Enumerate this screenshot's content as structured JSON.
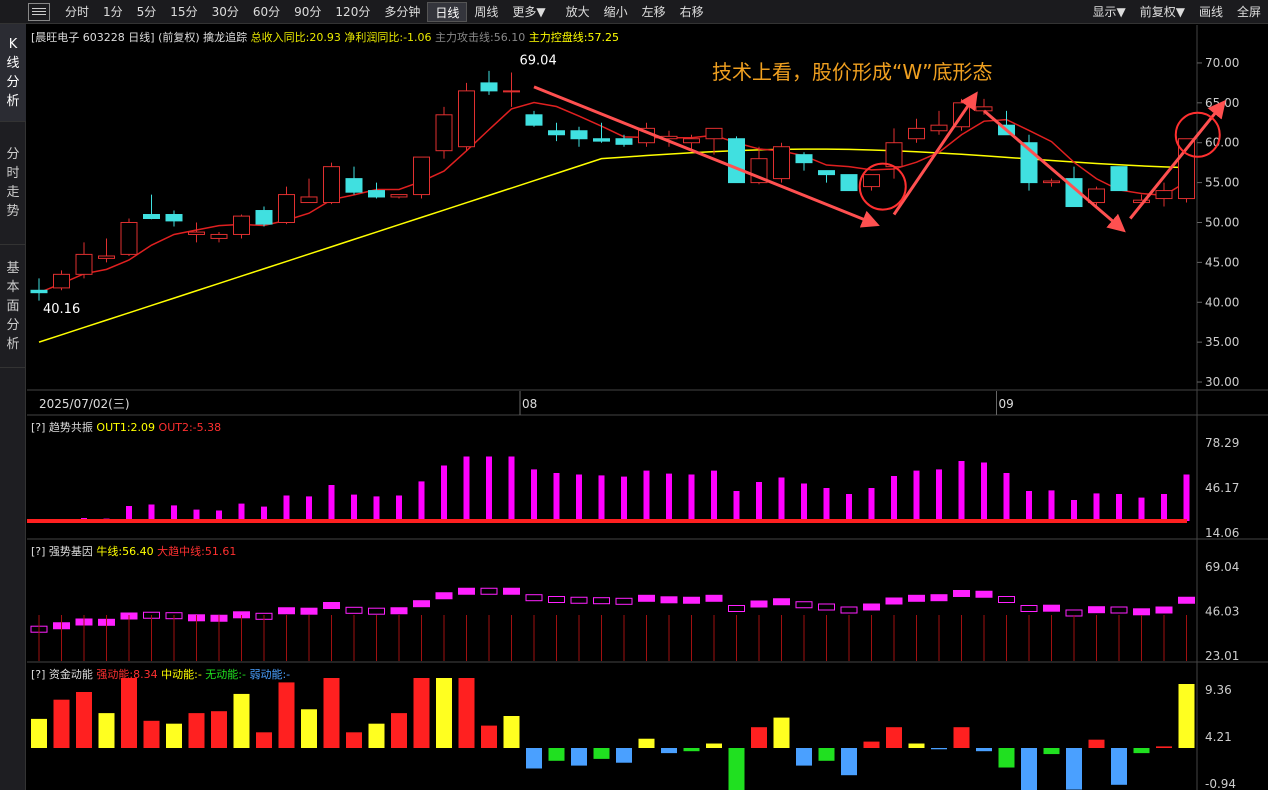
{
  "toolbar": {
    "periods": [
      "分时",
      "1分",
      "5分",
      "15分",
      "30分",
      "60分",
      "90分",
      "120分",
      "多分钟",
      "日线",
      "周线",
      "更多▼"
    ],
    "active": "日线",
    "actions": [
      "放大",
      "缩小",
      "左移",
      "右移"
    ],
    "right": [
      "显示▼",
      "前复权▼",
      "画线",
      "全屏"
    ]
  },
  "leftnav": [
    {
      "label": "K线分析",
      "active": true
    },
    {
      "label": "分时走势",
      "active": false
    },
    {
      "label": "基本面分析",
      "active": false
    }
  ],
  "main": {
    "stock": "[晨旺电子 603228 日线]",
    "adjust": "(前复权)",
    "indicator": "擒龙追踪",
    "fields": [
      {
        "text": "总收入同比:20.93",
        "color": "#e8e800"
      },
      {
        "text": "净利润同比:-1.06",
        "color": "#e8e800"
      },
      {
        "text": "主力攻击线:56.10",
        "color": "#888888"
      },
      {
        "text": "主力控盘线:57.25",
        "color": "#ffff00"
      }
    ],
    "yticks": [
      "70.00",
      "65.00",
      "60.00",
      "55.00",
      "50.00",
      "45.00",
      "40.00",
      "35.00",
      "30.00"
    ],
    "high_label": "69.04",
    "low_label": "40.16",
    "annotation": "技术上看，股价形成“W”底形态",
    "date_label": "2025/07/02(三)",
    "month_labels": [
      "08",
      "09"
    ]
  },
  "chart_data": {
    "type": "candlestick",
    "ylim": [
      29,
      72
    ],
    "candles": [
      [
        41.5,
        43,
        40.2,
        41.2
      ],
      [
        41.8,
        44,
        41.5,
        43.5
      ],
      [
        43.5,
        47.5,
        43,
        46
      ],
      [
        45.5,
        48,
        45,
        45.8
      ],
      [
        46,
        50.5,
        45.8,
        50
      ],
      [
        51,
        53.5,
        50.4,
        50.5
      ],
      [
        51,
        51.5,
        49.5,
        50.2
      ],
      [
        48.5,
        50,
        47.5,
        48.8
      ],
      [
        48,
        48.8,
        47.5,
        48.5
      ],
      [
        48.5,
        51,
        48,
        50.8
      ],
      [
        51.5,
        52,
        49.5,
        49.8
      ],
      [
        50,
        54.5,
        49.8,
        53.5
      ],
      [
        52.5,
        55.5,
        52.5,
        53.2
      ],
      [
        52.5,
        57.5,
        52.3,
        57
      ],
      [
        55.5,
        57,
        53.5,
        53.8
      ],
      [
        54,
        55,
        53,
        53.2
      ],
      [
        53.2,
        53.5,
        53,
        53.5
      ],
      [
        53.5,
        58,
        53,
        58.2
      ],
      [
        59,
        64.5,
        58,
        63.5
      ],
      [
        59.5,
        67.5,
        59,
        66.5
      ],
      [
        67.5,
        69,
        66,
        66.5
      ],
      [
        66.5,
        68.8,
        64.5,
        66.5
      ],
      [
        63.5,
        64,
        62,
        62.2
      ],
      [
        61.5,
        62.5,
        60.2,
        61
      ],
      [
        61.5,
        62,
        59.5,
        60.5
      ],
      [
        60.5,
        62.5,
        60,
        60.2
      ],
      [
        60.5,
        61,
        59.5,
        59.8
      ],
      [
        60,
        62.5,
        59.5,
        61.8
      ],
      [
        60.5,
        61.5,
        59.5,
        60.8
      ],
      [
        60,
        61,
        59,
        60.5
      ],
      [
        60.5,
        61.5,
        58.5,
        61.8
      ],
      [
        60.5,
        60.8,
        55,
        55
      ],
      [
        55,
        59.5,
        54.8,
        58
      ],
      [
        55.5,
        60,
        55,
        59.5
      ],
      [
        58.5,
        58.8,
        56.5,
        57.5
      ],
      [
        56.5,
        56.5,
        55,
        56
      ],
      [
        56,
        56,
        54,
        54
      ],
      [
        54.5,
        56,
        54,
        56
      ],
      [
        57,
        61.8,
        55.5,
        60
      ],
      [
        60.5,
        63,
        60,
        61.8
      ],
      [
        61.5,
        64,
        61,
        62.2
      ],
      [
        62,
        65.5,
        61.5,
        65
      ],
      [
        64,
        65.5,
        63.5,
        64.5
      ],
      [
        62.2,
        64,
        61.8,
        61
      ],
      [
        60,
        61,
        54,
        55
      ],
      [
        55,
        55.5,
        54.5,
        55.2
      ],
      [
        55.5,
        57,
        52.5,
        52
      ],
      [
        52.5,
        54.5,
        52,
        54.2
      ],
      [
        57,
        57,
        54,
        54
      ],
      [
        52.5,
        53.5,
        52,
        52.8
      ],
      [
        53,
        55,
        52,
        54
      ],
      [
        53,
        60,
        52.5,
        60.5
      ]
    ],
    "ma_fast_color": "#e02020",
    "ma_slow_color": "#ffff00",
    "panes": [
      {
        "name": "趋势共振",
        "series": [
          {
            "name": "OUT1",
            "last": "2.09",
            "color": "#ffff00"
          },
          {
            "name": "OUT2",
            "last": "-5.38",
            "color": "#ff3030"
          }
        ],
        "yticks": [
          "78.29",
          "46.17",
          "14.06"
        ]
      },
      {
        "name": "强势基因",
        "series": [
          {
            "name": "牛线",
            "last": "56.40",
            "color": "#ffff00"
          },
          {
            "name": "大趋中线",
            "last": "51.61",
            "color": "#ff3030"
          }
        ],
        "yticks": [
          "69.04",
          "46.03",
          "23.01"
        ]
      },
      {
        "name": "资金动能",
        "series": [
          {
            "name": "强动能",
            "last": "8.34",
            "color": "#ff3030"
          },
          {
            "name": "中动能",
            "last": "-",
            "color": "#ffff00"
          },
          {
            "name": "无动能",
            "last": "-",
            "color": "#20e020"
          },
          {
            "name": "弱动能",
            "last": "-",
            "color": "#4aa0ff"
          }
        ],
        "yticks": [
          "9.36",
          "4.21",
          "-0.94"
        ]
      }
    ]
  }
}
